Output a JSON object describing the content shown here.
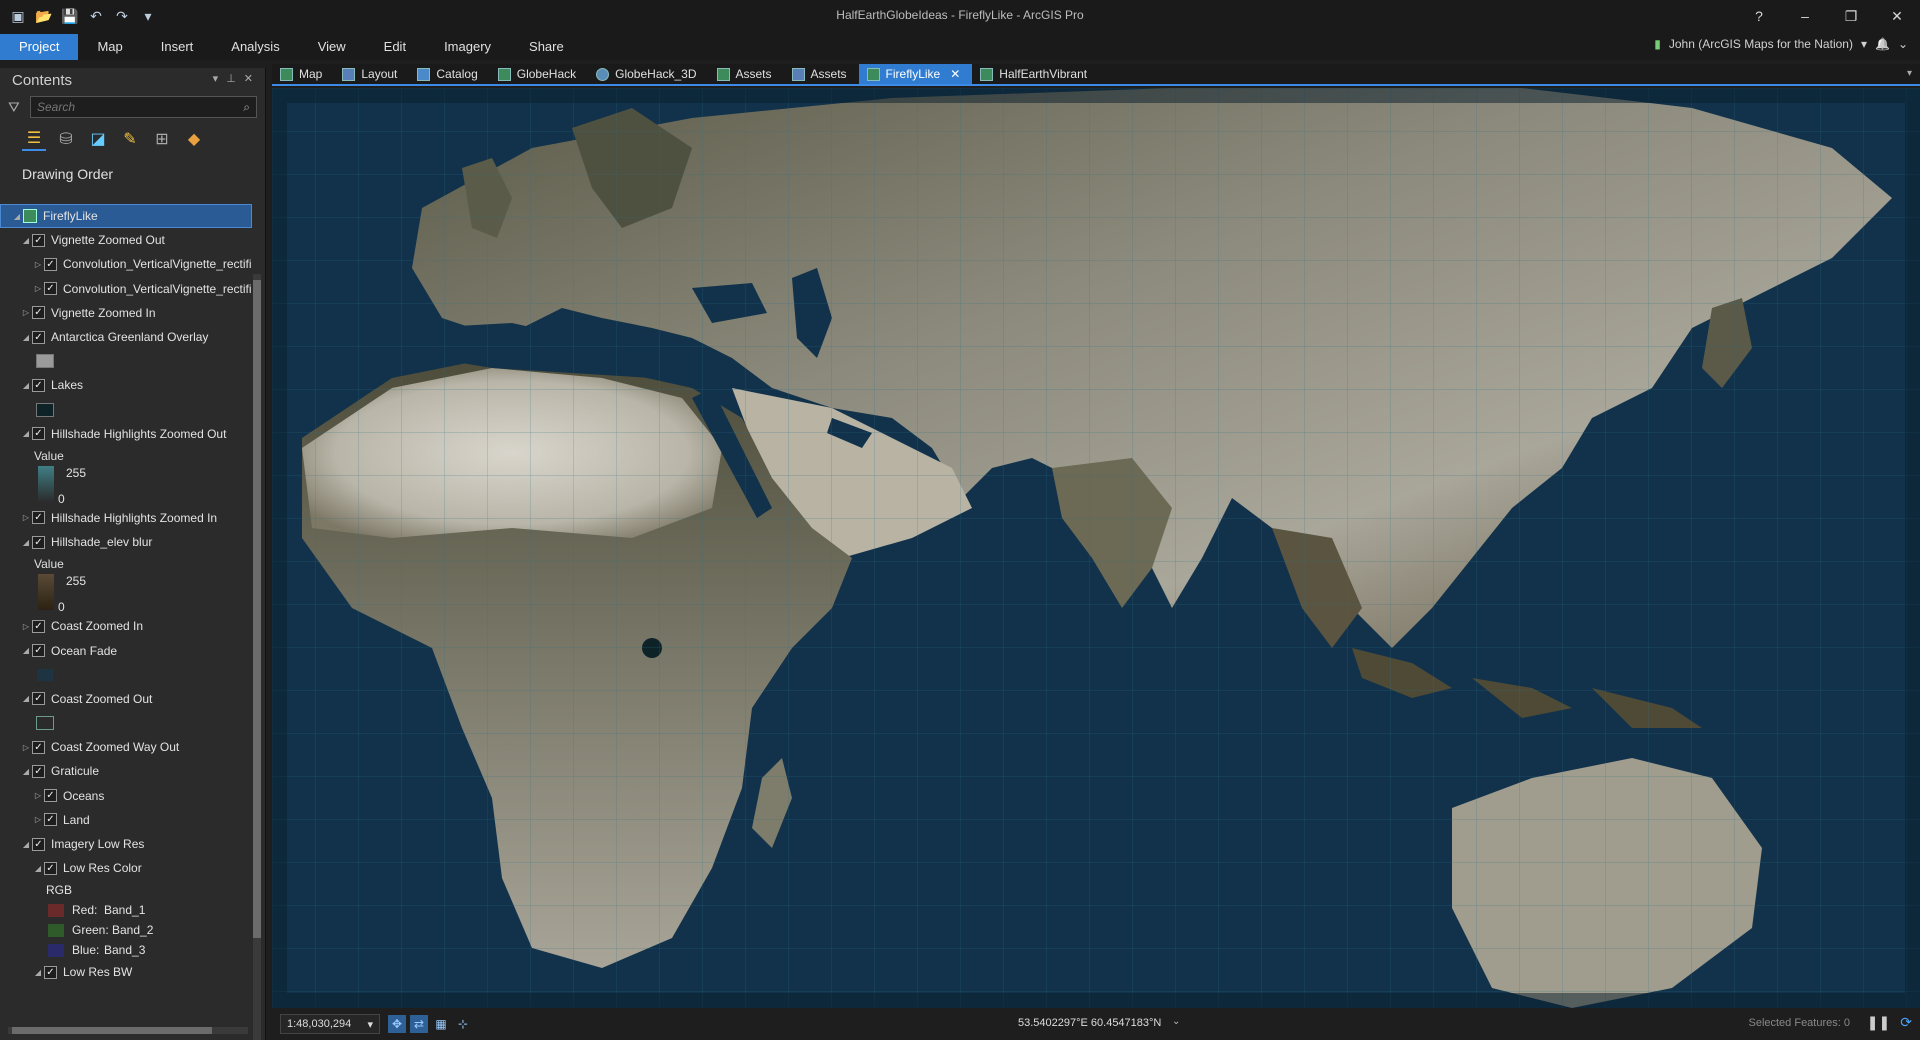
{
  "window": {
    "title": "HalfEarthGlobeIdeas - FireflyLike - ArcGIS Pro",
    "help": "?",
    "minimize": "–",
    "restore": "❐",
    "close": "✕"
  },
  "qat": {
    "icons": [
      "▣",
      "📂",
      "💾",
      "↶",
      "↷",
      "▾"
    ]
  },
  "ribbon": {
    "tabs": [
      "Project",
      "Map",
      "Insert",
      "Analysis",
      "View",
      "Edit",
      "Imagery",
      "Share"
    ],
    "user": "John (ArcGIS Maps for the Nation)",
    "user_caret": "▾",
    "bell": "🔔",
    "collapse": "⌄"
  },
  "contents": {
    "title": "Contents",
    "pane_buttons": [
      "▾",
      "⊥",
      "✕"
    ],
    "search_placeholder": "Search",
    "search_icon": "⌕",
    "drawing_order": "Drawing Order",
    "view_icons": [
      "☰",
      "⛁",
      "◪",
      "✎",
      "⊞",
      "◆"
    ],
    "layers": {
      "map": "FireflyLike",
      "vignette_out": "Vignette Zoomed Out",
      "conv1": "Convolution_VerticalVignette_rectified",
      "conv2": "Convolution_VerticalVignette_rectified",
      "vignette_in": "Vignette Zoomed In",
      "ant_green": "Antarctica Greenland Overlay",
      "lakes": "Lakes",
      "hh_out": "Hillshade Highlights Zoomed Out",
      "value1": "Value",
      "v1_hi": "255",
      "v1_lo": "0",
      "hh_in": "Hillshade Highlights Zoomed In",
      "elev_blur": "Hillshade_elev blur",
      "value2": "Value",
      "v2_hi": "255",
      "v2_lo": "0",
      "coast_in": "Coast Zoomed In",
      "ocean_fade": "Ocean Fade",
      "coast_out": "Coast Zoomed Out",
      "coast_way_out": "Coast Zoomed Way Out",
      "graticule": "Graticule",
      "oceans": "Oceans",
      "land": "Land",
      "imagery_low": "Imagery Low Res",
      "low_color": "Low Res Color",
      "rgb": "RGB",
      "red": "Red:",
      "red_band": "Band_1",
      "green": "Green:",
      "green_band": "Band_2",
      "blue": "Blue:",
      "blue_band": "Band_3",
      "low_bw": "Low Res BW"
    }
  },
  "view_tabs": {
    "tabs": [
      "Map",
      "Layout",
      "Catalog",
      "GlobeHack",
      "GlobeHack_3D",
      "Assets",
      "Assets",
      "FireflyLike",
      "HalfEarthVibrant"
    ],
    "close": "✕",
    "menu": "▾"
  },
  "status": {
    "scale": "1:48,030,294",
    "scale_caret": "▾",
    "coordinates": "53.5402297°E 60.4547183°N",
    "coords_caret": "⌄",
    "selected_features": "Selected Features: 0",
    "pause": "❚❚",
    "refresh": "⟳"
  },
  "colors": {
    "accent": "#2f7cd1",
    "ocean": "#0f2a3c",
    "land_light": "#c9c6bb",
    "land_dark": "#4c4a3a"
  }
}
